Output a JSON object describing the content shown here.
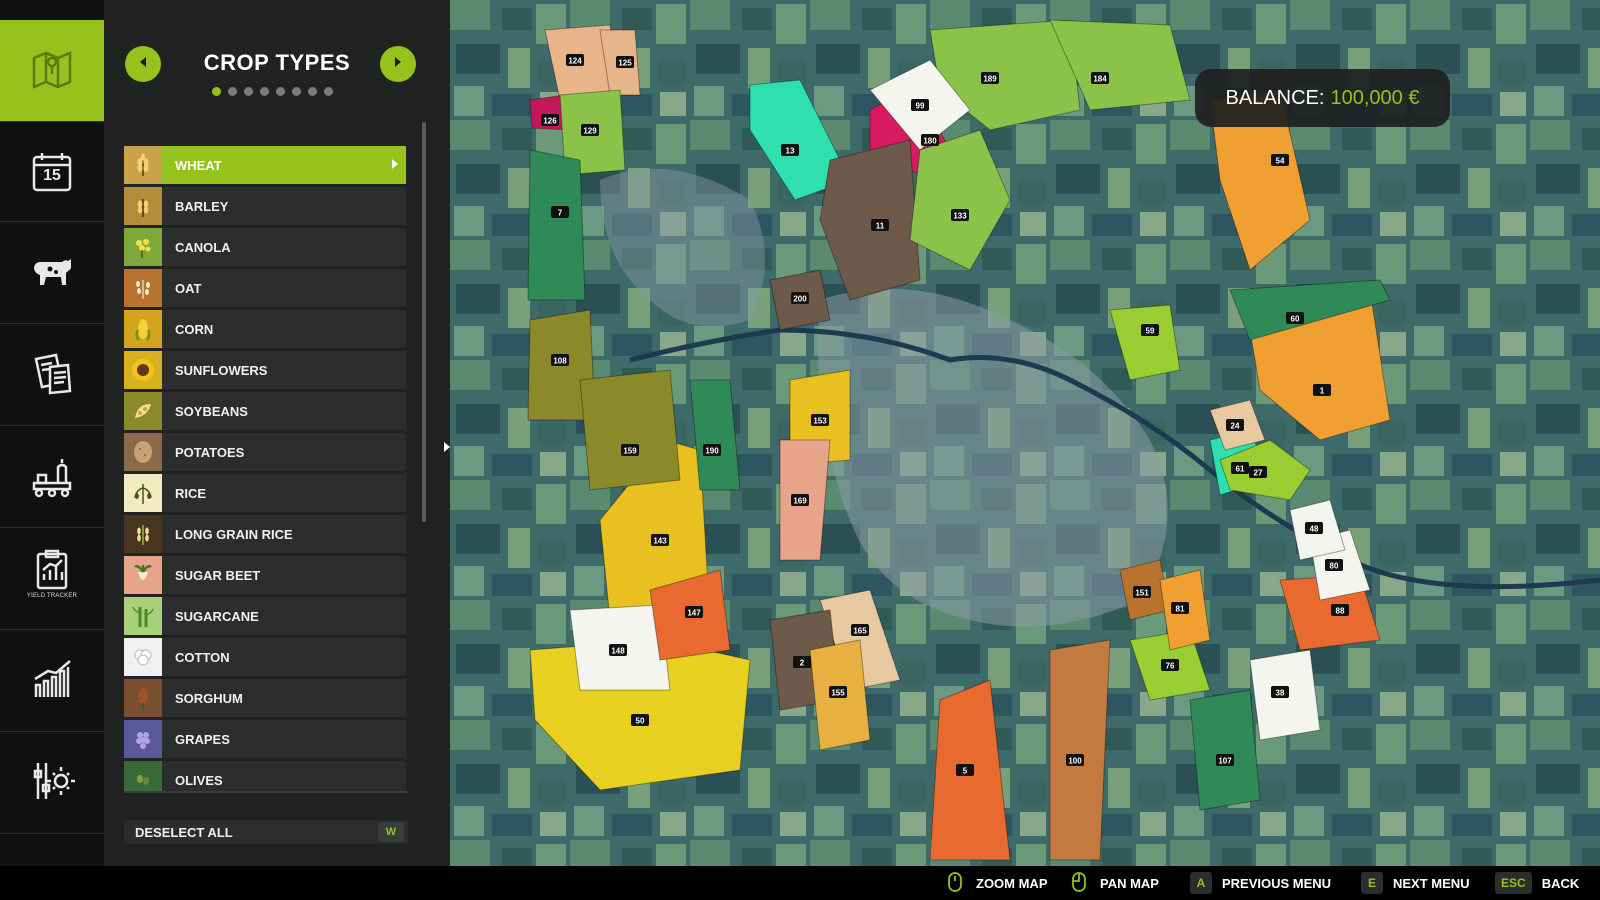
{
  "sidebar": {
    "items": [
      {
        "name": "map-icon",
        "active": true
      },
      {
        "name": "calendar-icon",
        "label": "15"
      },
      {
        "name": "livestock-icon"
      },
      {
        "name": "contracts-icon"
      },
      {
        "name": "production-icon"
      },
      {
        "name": "yield-tracker-icon",
        "caption": "YIELD TRACKER"
      },
      {
        "name": "statistics-icon"
      },
      {
        "name": "settings-icon"
      }
    ]
  },
  "panel": {
    "title": "CROP TYPES",
    "page_count": 8,
    "current_page": 1,
    "crops": [
      {
        "label": "WHEAT",
        "selected": true,
        "icon": "wheat-icon",
        "color": "#c9a24a"
      },
      {
        "label": "BARLEY",
        "icon": "barley-icon",
        "color": "#b58d3a"
      },
      {
        "label": "CANOLA",
        "icon": "canola-icon",
        "color": "#7fa83a"
      },
      {
        "label": "OAT",
        "icon": "oat-icon",
        "color": "#b8742f"
      },
      {
        "label": "CORN",
        "icon": "corn-icon",
        "color": "#d3a41e"
      },
      {
        "label": "SUNFLOWERS",
        "icon": "sunflower-icon",
        "color": "#d3b21e"
      },
      {
        "label": "SOYBEANS",
        "icon": "soybean-icon",
        "color": "#8a8a2a"
      },
      {
        "label": "POTATOES",
        "icon": "potato-icon",
        "color": "#8a6a4a"
      },
      {
        "label": "RICE",
        "icon": "rice-icon",
        "color": "#f2eac0"
      },
      {
        "label": "LONG GRAIN RICE",
        "icon": "long-grain-rice-icon",
        "color": "#4a3520"
      },
      {
        "label": "SUGAR BEET",
        "icon": "sugar-beet-icon",
        "color": "#e8a48a"
      },
      {
        "label": "SUGARCANE",
        "icon": "sugarcane-icon",
        "color": "#a8d07a"
      },
      {
        "label": "COTTON",
        "icon": "cotton-icon",
        "color": "#f0f0f0"
      },
      {
        "label": "SORGHUM",
        "icon": "sorghum-icon",
        "color": "#7a5030"
      },
      {
        "label": "GRAPES",
        "icon": "grapes-icon",
        "color": "#5a5a9a"
      },
      {
        "label": "OLIVES",
        "icon": "olives-icon",
        "color": "#3a6a3a"
      }
    ],
    "deselect_label": "DESELECT ALL",
    "deselect_key": "W"
  },
  "balance": {
    "label": "BALANCE:",
    "value": "100,000 €"
  },
  "hints": [
    {
      "key": "mouse",
      "label": "ZOOM MAP"
    },
    {
      "key": "mouse",
      "label": "PAN MAP"
    },
    {
      "key": "A",
      "label": "PREVIOUS MENU"
    },
    {
      "key": "E",
      "label": "NEXT MENU"
    },
    {
      "key": "ESC",
      "label": "BACK"
    }
  ],
  "colors": {
    "accent": "#96c21e",
    "panel": "#202322",
    "row": "#2b2e2d"
  },
  "map": {
    "fields": [
      {
        "id": "124",
        "color": "#e8b48a"
      },
      {
        "id": "125",
        "color": "#e8b48a"
      },
      {
        "id": "126",
        "color": "#c2185b"
      },
      {
        "id": "129",
        "color": "#8bc34a"
      },
      {
        "id": "7",
        "color": "#2e8b57"
      },
      {
        "id": "13",
        "color": "#2ee0b0"
      },
      {
        "id": "180",
        "color": "#d81b60"
      },
      {
        "id": "11",
        "color": "#6d5a4a"
      },
      {
        "id": "133",
        "color": "#8bc34a"
      },
      {
        "id": "189",
        "color": "#8bc34a"
      },
      {
        "id": "184",
        "color": "#8bc34a"
      },
      {
        "id": "54",
        "color": "#f0a030"
      },
      {
        "id": "1",
        "color": "#f0a030"
      },
      {
        "id": "60",
        "color": "#2e8b57"
      },
      {
        "id": "59",
        "color": "#9acd32"
      },
      {
        "id": "61",
        "color": "#2ee0b0"
      },
      {
        "id": "50",
        "color": "#e8d020"
      },
      {
        "id": "143",
        "color": "#e8c020"
      },
      {
        "id": "148",
        "color": "#f5f5f0"
      },
      {
        "id": "147",
        "color": "#e86a30"
      },
      {
        "id": "108",
        "color": "#8a8a2a"
      },
      {
        "id": "159",
        "color": "#8a8a2a"
      },
      {
        "id": "190",
        "color": "#2e8b57"
      },
      {
        "id": "153",
        "color": "#e8c020"
      },
      {
        "id": "165",
        "color": "#e8c8a0"
      },
      {
        "id": "5",
        "color": "#e86a30"
      },
      {
        "id": "100",
        "color": "#c27a40"
      },
      {
        "id": "76",
        "color": "#9acd32"
      },
      {
        "id": "88",
        "color": "#e86a30"
      },
      {
        "id": "27",
        "color": "#9acd32"
      },
      {
        "id": "200",
        "color": "#6d5a4a"
      },
      {
        "id": "169",
        "color": "#e8a48a"
      },
      {
        "id": "151",
        "color": "#b8742f"
      },
      {
        "id": "81",
        "color": "#f0a030"
      },
      {
        "id": "80",
        "color": "#f5f5f0"
      },
      {
        "id": "24",
        "color": "#e8c8a0"
      },
      {
        "id": "48",
        "color": "#f5f5f0"
      },
      {
        "id": "38",
        "color": "#f5f5f0"
      },
      {
        "id": "2",
        "color": "#6d5a4a"
      },
      {
        "id": "155",
        "color": "#e8b040"
      },
      {
        "id": "107",
        "color": "#2e8b57"
      },
      {
        "id": "99",
        "color": "#f5f5f0"
      }
    ]
  }
}
